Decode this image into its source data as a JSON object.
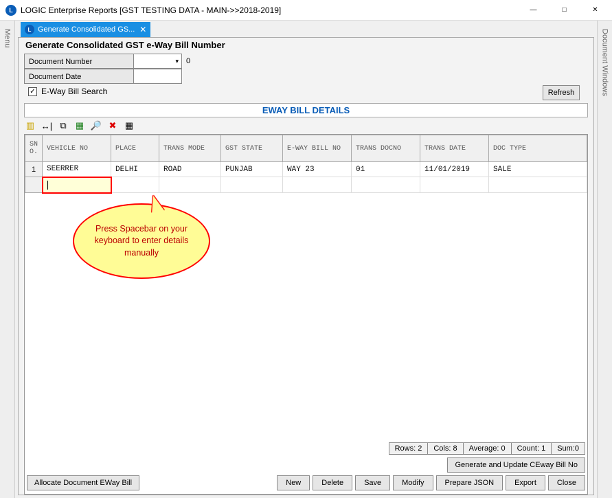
{
  "window": {
    "title": "LOGIC Enterprise Reports  [GST TESTING DATA - MAIN->>2018-2019]"
  },
  "sideTabs": {
    "left": "Menu",
    "right": "Document Windows"
  },
  "docTab": {
    "label": "Generate Consolidated GS..."
  },
  "panel": {
    "heading": "Generate Consolidated GST e-Way Bill Number",
    "docNumberLabel": "Document Number",
    "docNumberAfter": "0",
    "docDateLabel": "Document Date",
    "ewaySearchLabel": "E-Way Bill Search",
    "ewaySearchChecked": true,
    "refresh": "Refresh"
  },
  "sectionTitle": "EWAY BILL DETAILS",
  "grid": {
    "columns": [
      "SN O.",
      "VEHICLE NO",
      "PLACE",
      "TRANS MODE",
      "GST STATE",
      "E-WAY BILL NO",
      "TRANS DOCNO",
      "TRANS DATE",
      "DOC TYPE"
    ],
    "rows": [
      {
        "sn": "1",
        "vehicleNo": "SEERRER",
        "place": "DELHI",
        "transMode": "ROAD",
        "gstState": "PUNJAB",
        "ewayBillNo": "WAY 23",
        "transDocNo": "01",
        "transDate": "11/01/2019",
        "docType": "SALE"
      }
    ],
    "editRowSn": ""
  },
  "callout": "Press  Spacebar  on your  keyboard  to enter  details  manually",
  "status": {
    "rows": "Rows: 2",
    "cols": "Cols: 8",
    "avg": "Average: 0",
    "count": "Count: 1",
    "sum": "Sum:0"
  },
  "buttons": {
    "generateUpdate": "Generate and Update CEway Bill No",
    "allocate": "Allocate Document EWay Bill",
    "new": "New",
    "delete": "Delete",
    "save": "Save",
    "modify": "Modify",
    "prepareJson": "Prepare JSON",
    "export": "Export",
    "close": "Close"
  }
}
